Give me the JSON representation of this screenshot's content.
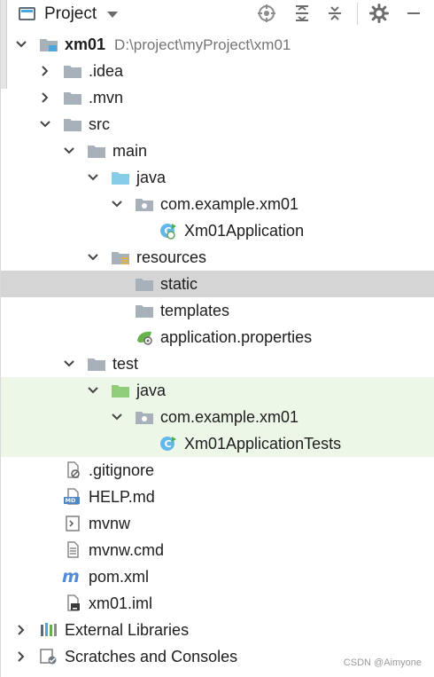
{
  "toolbar": {
    "title": "Project",
    "icons": [
      "target-icon",
      "expand-all-icon",
      "collapse-all-icon",
      "gear-icon",
      "minus-icon"
    ]
  },
  "tree": {
    "root": {
      "label": "xm01",
      "path": "D:\\project\\myProject\\xm01"
    },
    "items": {
      "idea": ".idea",
      "mvn": ".mvn",
      "src": "src",
      "main": "main",
      "java_main": "java",
      "package_main": "com.example.xm01",
      "app_class": "Xm01Application",
      "resources": "resources",
      "static": "static",
      "templates": "templates",
      "application_properties": "application.properties",
      "test": "test",
      "java_test": "java",
      "package_test": "com.example.xm01",
      "test_class": "Xm01ApplicationTests",
      "gitignore": ".gitignore",
      "help_md": "HELP.md",
      "mvnw": "mvnw",
      "mvnw_cmd": "mvnw.cmd",
      "pom_xml": "pom.xml",
      "iml": "xm01.iml",
      "external_libraries": "External Libraries",
      "scratches": "Scratches and Consoles"
    }
  },
  "watermark": "CSDN @Aimyone",
  "colors": {
    "selected": "#d5d5d5",
    "test_background": "#edf7e8",
    "folder_gray": "#a8b1b9",
    "java_blue": "#86cdea",
    "java_test_green": "#8fcd78",
    "accent_blue": "#4ea5dc"
  }
}
